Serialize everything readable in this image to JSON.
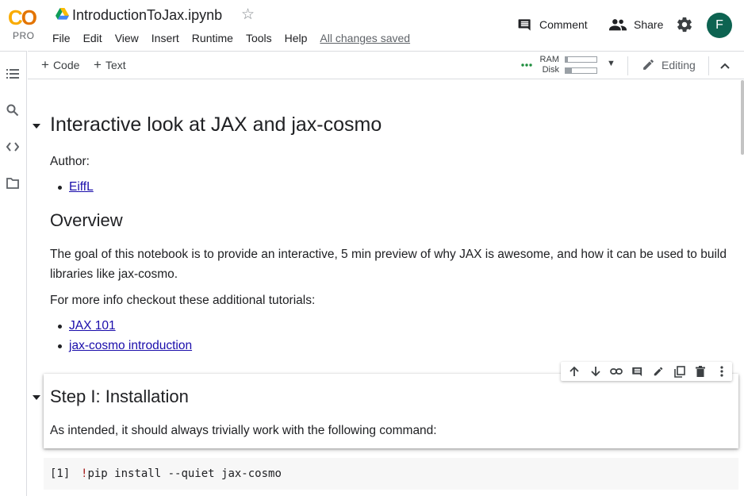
{
  "app": {
    "logo_text": "CO",
    "plan_badge": "PRO",
    "notebook_title": "IntroductionToJax.ipynb",
    "brand_colors": {
      "logo_yellow": "#f9ab00",
      "logo_orange": "#e37400",
      "avatar_bg": "#0d6351",
      "link": "#1a0dab"
    }
  },
  "menu": {
    "items": [
      "File",
      "Edit",
      "View",
      "Insert",
      "Runtime",
      "Tools",
      "Help"
    ],
    "save_status": "All changes saved"
  },
  "header_actions": {
    "comment_label": "Comment",
    "share_label": "Share",
    "avatar_initial": "F"
  },
  "sidebar": {
    "icons": [
      "table-of-contents-icon",
      "search-icon",
      "code-snippets-icon",
      "files-icon"
    ]
  },
  "toolbar": {
    "add_code_label": "Code",
    "add_text_label": "Text",
    "ram_label": "RAM",
    "disk_label": "Disk",
    "ram_usage": 0.08,
    "disk_usage": 0.2,
    "status_color": "#1e8e3e",
    "mode_label": "Editing"
  },
  "notebook": {
    "heading_main": "Interactive look at JAX and jax-cosmo",
    "author_label": "Author:",
    "author_link": "EiffL",
    "overview_heading": "Overview",
    "overview_text": "The goal of this notebook is to provide an interactive, 5 min preview of why JAX is awesome, and how it can be used to build libraries like jax-cosmo.",
    "more_info_text": "For more info checkout these additional tutorials:",
    "tutorial_links": [
      "JAX 101",
      "jax-cosmo introduction"
    ],
    "step1_heading": "Step I: Installation",
    "step1_text": "As intended, it should always trivially work with the following command:",
    "code_cell": {
      "execution_count": "[1]",
      "code_bang": "!",
      "code_rest": "pip install --quiet jax-cosmo"
    },
    "cell_toolbar_icons": [
      "move-up-icon",
      "move-down-icon",
      "link-icon",
      "comment-icon",
      "edit-icon",
      "mirror-cell-icon",
      "delete-icon",
      "more-icon"
    ]
  }
}
